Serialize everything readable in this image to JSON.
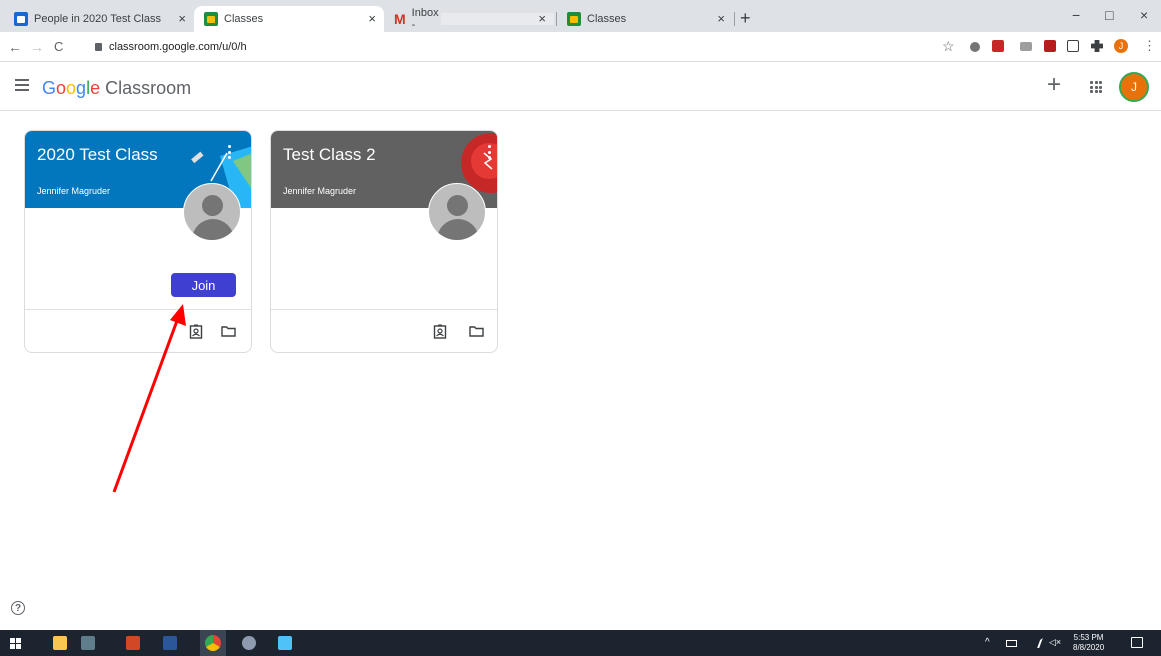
{
  "browser": {
    "tabs": [
      {
        "title": "People in 2020 Test Class",
        "close": "×"
      },
      {
        "title": "Classes",
        "close": "×"
      },
      {
        "title": "Inbox - ",
        "close": "×"
      },
      {
        "title": "Classes",
        "close": "×"
      }
    ],
    "new_tab": "+",
    "window_controls": {
      "minimize": "−",
      "maximize": "□",
      "close": "×"
    },
    "nav": {
      "back": "←",
      "forward": "→",
      "reload": "C"
    },
    "url": "classroom.google.com/u/0/h",
    "star": "☆",
    "profile_initial": "J",
    "menu": "⋮"
  },
  "app": {
    "logo": {
      "g": "G",
      "o1": "o",
      "o2": "o",
      "g2": "g",
      "l": "l",
      "e": "e",
      "product": "Classroom"
    },
    "plus": "+",
    "avatar_initial": "J"
  },
  "cards": [
    {
      "title": "2020 Test Class",
      "teacher": "Jennifer Magruder",
      "banner_color": "#0277bd",
      "join_label": "Join"
    },
    {
      "title": "Test Class 2",
      "teacher": "Jennifer Magruder",
      "banner_color": "#616161"
    }
  ],
  "help": "?",
  "taskbar": {
    "clock_time": "5:53 PM",
    "clock_date": "8/8/2020",
    "tray_up": "^",
    "volume": "◁×"
  },
  "colors": {
    "annotation_arrow": "#ff0000",
    "join_button": "#3f3fd1"
  }
}
